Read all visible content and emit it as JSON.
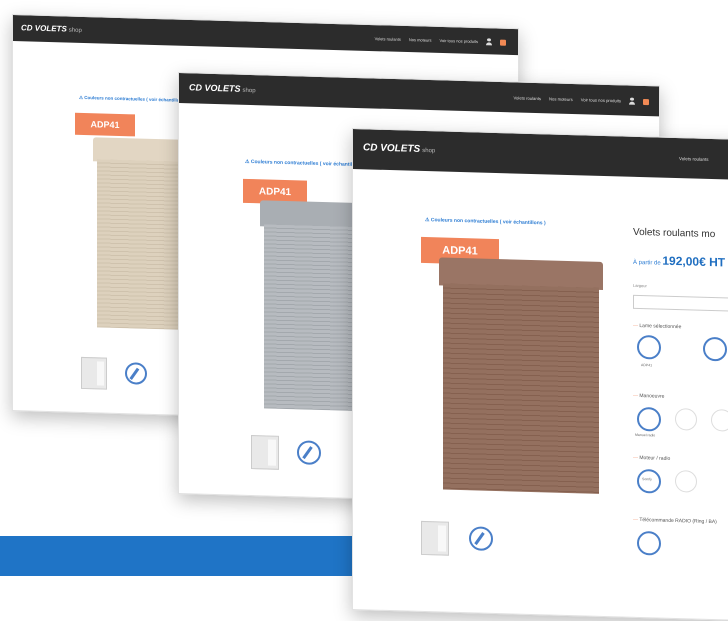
{
  "brand": {
    "name": "CD VOLETS",
    "tag": "shop"
  },
  "nav": {
    "item1": "Volets roulants",
    "item2": "Nos moteurs",
    "item3": "Voir tous nos produits"
  },
  "notice": "⚠ Couleurs non contractuelles ( voir échantillons )",
  "badge": "ADP41",
  "product": {
    "title": "Volets roulants mo",
    "price_prefix": "À partir de",
    "price": "192,00€ HT",
    "field_label": "Largeur",
    "sections": [
      "Lame sélectionnée",
      "Manoeuvre",
      "Moteur / radio",
      "Télécommande RADIO (Ring / BA)"
    ],
    "option_caption_1": "ADP41",
    "option_caption_2": "Manuel radio",
    "option_caption_3": "Somfy"
  },
  "colors": {
    "shutter1_box": "#e2d6c3",
    "shutter1_slats": "#ddd1bd",
    "shutter2_box": "#a9aeb3",
    "shutter2_slats": "#b4b8bc",
    "shutter3_box": "#9a7565",
    "shutter3_slats": "#8f6b5c",
    "accent": "#2c7cd3",
    "badge": "#f1845a",
    "band": "#1f74c6"
  }
}
